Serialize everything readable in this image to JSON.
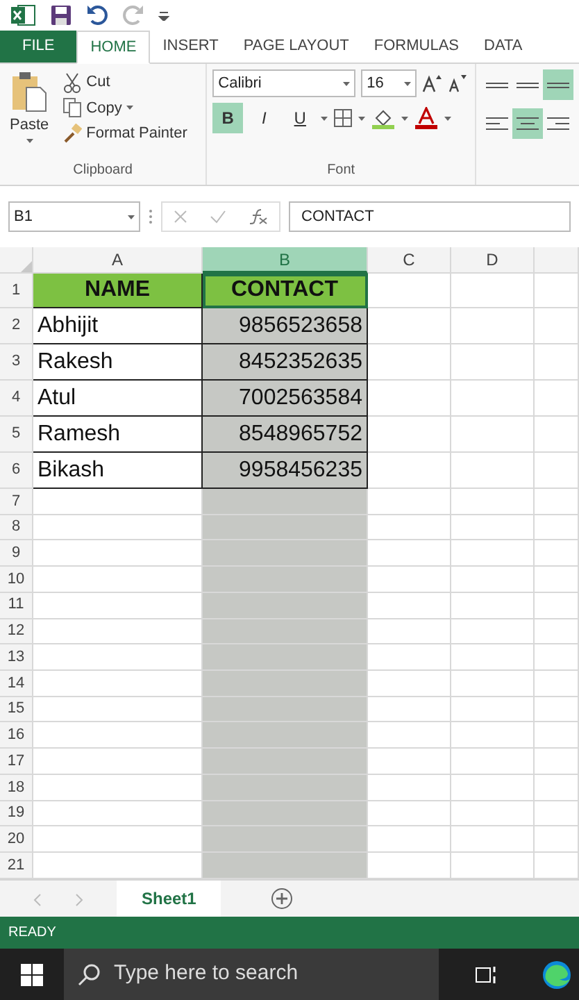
{
  "quick_access": [
    {
      "kind": "undo",
      "disabled": false
    },
    {
      "kind": "redo",
      "disabled": true
    }
  ],
  "ribbon_tabs": [
    {
      "label": "FILE",
      "kind": "file",
      "selected": false
    },
    {
      "label": "HOME",
      "kind": "tab",
      "selected": true
    },
    {
      "label": "INSERT",
      "kind": "tab",
      "selected": false
    },
    {
      "label": "PAGE LAYOUT",
      "kind": "tab",
      "selected": false
    },
    {
      "label": "FORMULAS",
      "kind": "tab",
      "selected": false
    },
    {
      "label": "DATA",
      "kind": "tab",
      "selected": false
    }
  ],
  "clipboard": {
    "paste": "Paste",
    "items": [
      {
        "kind": "cut",
        "label": "Cut"
      },
      {
        "kind": "copy",
        "label": "Copy"
      },
      {
        "kind": "painter",
        "label": "Format Painter"
      }
    ],
    "label": "Clipboard"
  },
  "font": {
    "font_name": "Calibri",
    "font_size": "16",
    "label": "Font",
    "buttons": [
      {
        "kind": "bold",
        "label": "B",
        "on": true
      },
      {
        "kind": "italic",
        "label": "I",
        "on": false
      },
      {
        "kind": "underline",
        "label": "U",
        "on": false
      }
    ]
  },
  "alignment": [
    {
      "kind": "top",
      "on": false
    },
    {
      "kind": "middle",
      "on": false
    },
    {
      "kind": "bottom",
      "on": true
    },
    {
      "kind": "left",
      "on": false
    },
    {
      "kind": "center",
      "on": true
    },
    {
      "kind": "right",
      "on": false
    }
  ],
  "formula_bar": {
    "name_box": "B1",
    "formula": "CONTACT"
  },
  "columns": [
    {
      "label": "A",
      "selected": false
    },
    {
      "label": "B",
      "selected": true
    },
    {
      "label": "C",
      "selected": false
    },
    {
      "label": "D",
      "selected": false
    }
  ],
  "rows": [
    {
      "header": "1",
      "cells": [
        {
          "text": "NAME",
          "kind": "header",
          "active": false
        },
        {
          "text": "CONTACT",
          "kind": "header",
          "active": true
        }
      ]
    },
    {
      "header": "2",
      "cells": [
        {
          "text": "Abhijit",
          "kind": "text",
          "active": false
        },
        {
          "text": "9856523658",
          "kind": "number",
          "active": false
        }
      ]
    },
    {
      "header": "3",
      "cells": [
        {
          "text": "Rakesh",
          "kind": "text",
          "active": false
        },
        {
          "text": "8452352635",
          "kind": "number",
          "active": false
        }
      ]
    },
    {
      "header": "4",
      "cells": [
        {
          "text": "Atul",
          "kind": "text",
          "active": false
        },
        {
          "text": "7002563584",
          "kind": "number",
          "active": false
        }
      ]
    },
    {
      "header": "5",
      "cells": [
        {
          "text": "Ramesh",
          "kind": "text",
          "active": false
        },
        {
          "text": "8548965752",
          "kind": "number",
          "active": false
        }
      ]
    },
    {
      "header": "6",
      "cells": [
        {
          "text": "Bikash",
          "kind": "text",
          "active": false
        },
        {
          "text": "9958456235",
          "kind": "number",
          "active": false
        }
      ]
    },
    {
      "header": "7"
    },
    {
      "header": "8"
    },
    {
      "header": "9"
    },
    {
      "header": "10"
    },
    {
      "header": "11"
    },
    {
      "header": "12"
    },
    {
      "header": "13"
    },
    {
      "header": "14"
    },
    {
      "header": "15"
    },
    {
      "header": "16"
    },
    {
      "header": "17"
    },
    {
      "header": "18"
    },
    {
      "header": "19"
    },
    {
      "header": "20"
    },
    {
      "header": "21"
    }
  ],
  "sheet_tabs": [
    {
      "label": "Sheet1",
      "selected": true
    }
  ],
  "status": "READY",
  "taskbar": {
    "search_placeholder": "Type here to search"
  }
}
